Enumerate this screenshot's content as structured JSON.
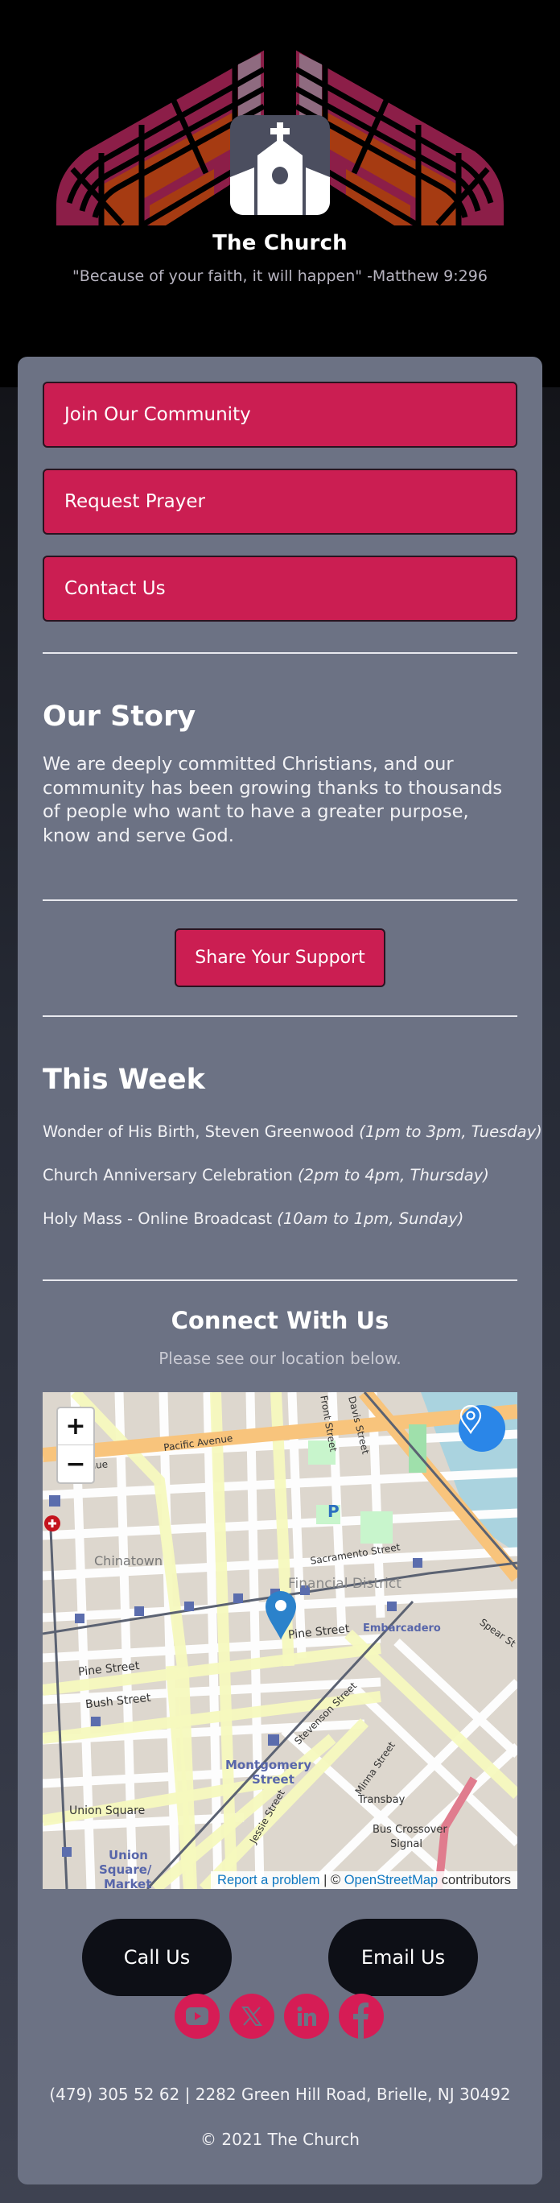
{
  "header": {
    "title": "The Church",
    "tagline": "\"Because of your faith, it will happen\" -Matthew 9:296",
    "logo_icon": "church-icon"
  },
  "nav": {
    "buttons": [
      {
        "label": "Join Our Community"
      },
      {
        "label": "Request Prayer"
      },
      {
        "label": "Contact Us"
      }
    ]
  },
  "story": {
    "heading": "Our Story",
    "body": "We are deeply committed Christians, and our community has been growing thanks to thousands of people who want to have a greater purpose, know and serve God."
  },
  "support": {
    "button_label": "Share Your Support"
  },
  "this_week": {
    "heading": "This Week",
    "events": [
      {
        "title": "Wonder of His Birth, Steven Greenwood",
        "time": "(1pm to 3pm, Tuesday)"
      },
      {
        "title": "Church Anniversary Celebration",
        "time": "(2pm to 4pm, Thursday)"
      },
      {
        "title": "Holy Mass - Online Broadcast",
        "time": "(10am to 1pm, Sunday)"
      }
    ]
  },
  "connect": {
    "heading": "Connect With Us",
    "subtitle": "Please see our location below."
  },
  "map": {
    "zoom_in": "+",
    "zoom_out": "−",
    "attribution": {
      "report": "Report a problem",
      "separator": " | © ",
      "osm": "OpenStreetMap",
      "suffix": " contributors"
    },
    "labels": {
      "pacific": "Pacific Avenue",
      "avenue": "venue",
      "front": "Front Street",
      "davis": "Davis Street",
      "chinatown": "Chinatown",
      "sacramento": "Sacramento Street",
      "financial": "Financial District",
      "pine1": "Pine Street",
      "pine2": "Pine Street",
      "bush": "Bush Street",
      "embarcadero": "Embarcadero",
      "spear": "Spear St",
      "stevenson": "Stevenson Street",
      "montgomery1": "Montgomery",
      "montgomery2": "Street",
      "union_square": "Union Square",
      "usm1": "Union",
      "usm2": "Square/",
      "usm3": "Market",
      "jessie": "Jessie Street",
      "minna": "Minna Street",
      "transbay": "Transbay",
      "bus1": "Bus Crossover",
      "bus2": "Signal",
      "parking": "P"
    }
  },
  "contact": {
    "call_label": "Call Us",
    "email_label": "Email Us",
    "social": [
      {
        "name": "youtube-icon"
      },
      {
        "name": "x-icon"
      },
      {
        "name": "linkedin-icon"
      },
      {
        "name": "facebook-icon"
      }
    ]
  },
  "footer": {
    "contact_line": "(479) 305 52 62 | 2282 Green Hill Road, Brielle, NJ 30492",
    "copyright": "© 2021 The Church"
  },
  "colors": {
    "accent": "#cb1e52",
    "card": "#6c7284",
    "pill": "#0d0f16",
    "social": "#d61c55"
  }
}
